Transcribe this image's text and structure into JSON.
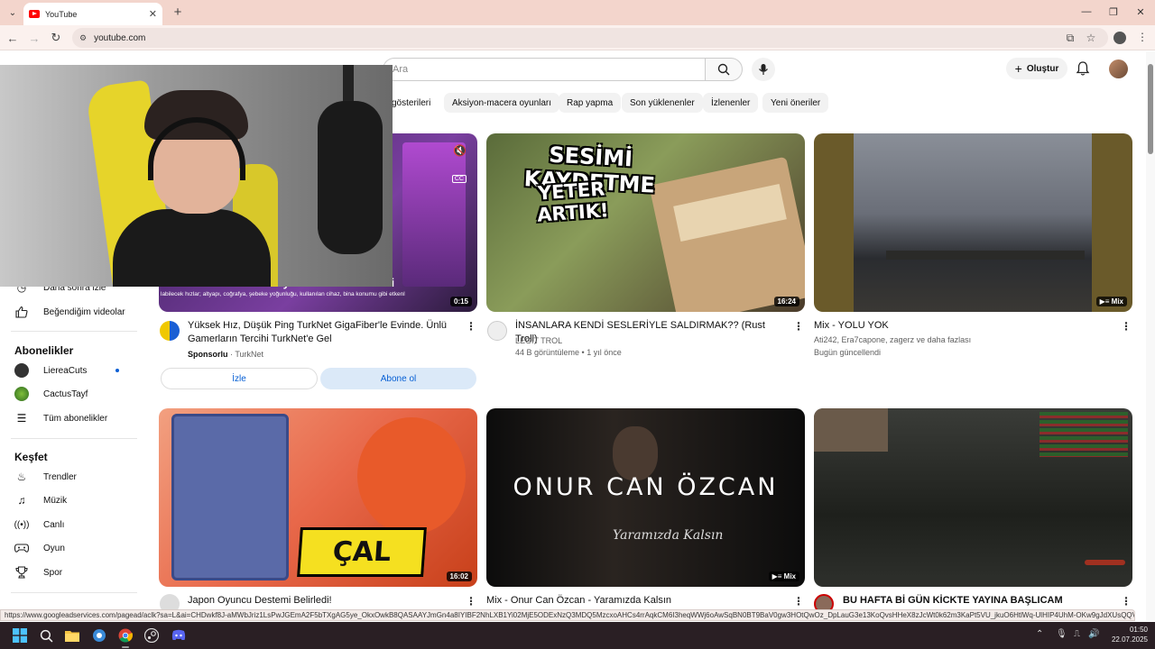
{
  "browser": {
    "tab_title": "YouTube",
    "url": "youtube.com",
    "status_url": "https://www.googleadservices.com/pagead/aclk?sa=L&ai=CHDwkf8J-aMWbJriz1LsPwJGEmA2F5bTXgAG5ye_OkxOwkB8QASAAYJmGn4a8IYIBF2NhLXB1Yi02MjE5ODExNzQ3MDQ5MzcxoAHCs4rrAqkCM6I3heqWWj6oAwSqBN0BT9BaV0gw3HOtQwOz_DpLauG3e13KoQvsHHeX8zJcWt0k62m3KaPt5VU_jkuO6HtlWq-UlHIP4UhM-OKw9gJdXUsQQVWWzzbAD..."
  },
  "header": {
    "search_placeholder": "Ara",
    "create_label": "Oluştur"
  },
  "chips": [
    "gösterileri",
    "Aksiyon-macera oyunları",
    "Rap yapma",
    "Son yüklenenler",
    "İzlenenler",
    "Yeni öneriler"
  ],
  "sidebar": {
    "watch_later": "Daha sonra izle",
    "liked": "Beğendiğim videolar",
    "subs_heading": "Abonelikler",
    "subs": [
      "LiereaCuts",
      "CactusTayf"
    ],
    "all_subs": "Tüm abonelikler",
    "explore_heading": "Keşfet",
    "explore": [
      "Trendler",
      "Müzik",
      "Canlı",
      "Oyun",
      "Spor"
    ]
  },
  "ad": {
    "title": "Yüksek Hız, Düşük Ping TurkNet GigaFiber'le Evinde. Ünlü Gamerların Tercihi TurkNet'e Gel",
    "sponsored": "Sponsorlu",
    "advertiser": "TurkNet",
    "watch_btn": "İzle",
    "subscribe_btn": "Abone ol",
    "duration": "0:15",
    "overlay_text": "AFK mı kalacaktın yani kalmazsın Hadi",
    "caption_text": "labilecek hızlar; altyapı, coğrafya, şebeke yoğunluğu, kullanılan cihaz, bina konumu gibi etkenl"
  },
  "videos": [
    {
      "title": "İNSANLARA KENDİ SESLERİYLE SALDIRMAK?? (Rust Troll)",
      "channel": "LEGIT TROL",
      "stats": "44 B görüntüleme • 1 yıl önce",
      "duration": "16:24",
      "thumb_line1": "SESİMİ KAYDETME",
      "thumb_line2": "YETER ARTIK!"
    },
    {
      "title": "Mix - YOLU YOK",
      "channel": "Ati242, Era7capone, zagerz ve daha fazlası",
      "stats": "Bugün güncellendi",
      "badge": "Mix"
    },
    {
      "title": "Japon Oyuncu Destemi Belirledi!",
      "duration": "16:02",
      "thumb_text": "ÇAL"
    },
    {
      "title": "Mix - Onur Can Özcan - Yaramızda Kalsın",
      "badge": "Mix",
      "thumb_line1": "ONUR CAN ÖZCAN",
      "thumb_line2": "Yaramızda Kalsın"
    },
    {
      "title": "BU HAFTA Bİ GÜN KİCKTE YAYINA BAŞLICAM AÇIKLAMADA"
    }
  ],
  "taskbar": {
    "time": "01:50",
    "date": "22.07.2025"
  },
  "colors": {
    "tab_strip": "#f3d5cc",
    "yt_red": "#ff0000",
    "subscribe_bg": "#dbe9f8",
    "taskbar": "#2a1f24"
  }
}
